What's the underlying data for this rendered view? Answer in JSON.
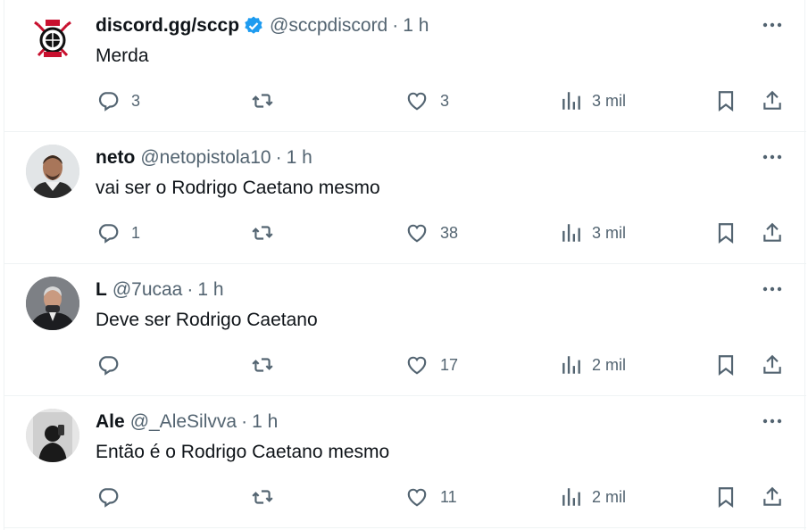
{
  "colors": {
    "text": "#0f1419",
    "muted": "#536471",
    "verified": "#1d9bf0",
    "border": "#eff3f4"
  },
  "icons": [
    "reply-icon",
    "retweet-icon",
    "like-icon",
    "views-icon",
    "bookmark-icon",
    "share-icon",
    "more-icon",
    "verified-badge-icon"
  ],
  "tweets": [
    {
      "name": "discord.gg/sccp",
      "verified": true,
      "handle": "@sccpdiscord",
      "dot": "·",
      "time": "1 h",
      "text": "Merda",
      "replies": "3",
      "retweets": "",
      "likes": "3",
      "views": "3 mil",
      "avatar": "corinthians-crest"
    },
    {
      "name": "neto",
      "verified": false,
      "handle": "@netopistola10",
      "dot": "·",
      "time": "1 h",
      "text": "vai ser o Rodrigo Caetano mesmo",
      "replies": "1",
      "retweets": "",
      "likes": "38",
      "views": "3 mil",
      "avatar": "player-photo"
    },
    {
      "name": "L",
      "verified": false,
      "handle": "@7ucaa",
      "dot": "·",
      "time": "1 h",
      "text": "Deve ser Rodrigo Caetano",
      "replies": "",
      "retweets": "",
      "likes": "17",
      "views": "2 mil",
      "avatar": "man-in-suit-photo"
    },
    {
      "name": "Ale",
      "verified": false,
      "handle": "@_AleSilvva",
      "dot": "·",
      "time": "1 h",
      "text": "Então é o Rodrigo Caetano mesmo",
      "replies": "",
      "retweets": "",
      "likes": "11",
      "views": "2 mil",
      "avatar": "mirror-selfie-photo"
    }
  ]
}
